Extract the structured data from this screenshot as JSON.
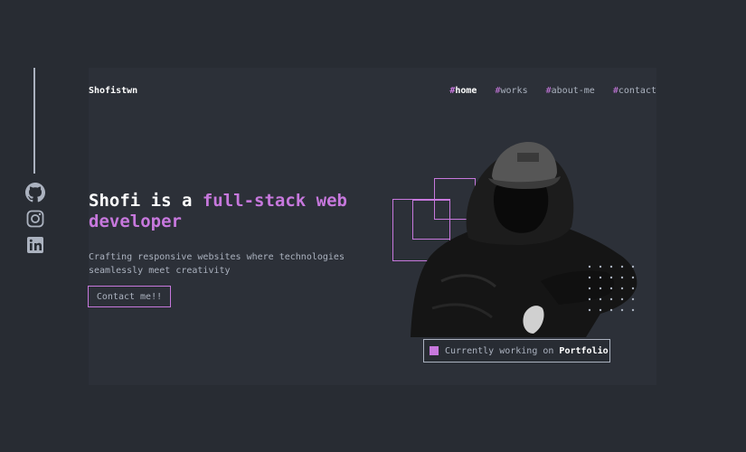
{
  "brand": {
    "name": "Shofistwn"
  },
  "nav": {
    "items": [
      {
        "hash": "#",
        "label": "home",
        "active": true
      },
      {
        "hash": "#",
        "label": "works",
        "active": false
      },
      {
        "hash": "#",
        "label": "about-me",
        "active": false
      },
      {
        "hash": "#",
        "label": "contact",
        "active": false
      }
    ]
  },
  "hero": {
    "headline_prefix": "Shofi is a ",
    "headline_accent": "full-stack web developer",
    "subtext": "Crafting responsive websites where technologies seamlessly meet creativity",
    "cta_label": "Contact me!!"
  },
  "status": {
    "prefix": "Currently working on",
    "project": "Portfolio"
  },
  "social": [
    {
      "icon": "github-icon"
    },
    {
      "icon": "instagram-icon"
    },
    {
      "icon": "linkedin-icon"
    }
  ],
  "colors": {
    "background": "#282c33",
    "card": "#2c3038",
    "accent": "#c778dd",
    "text": "#abb2bf",
    "white": "#ffffff"
  }
}
